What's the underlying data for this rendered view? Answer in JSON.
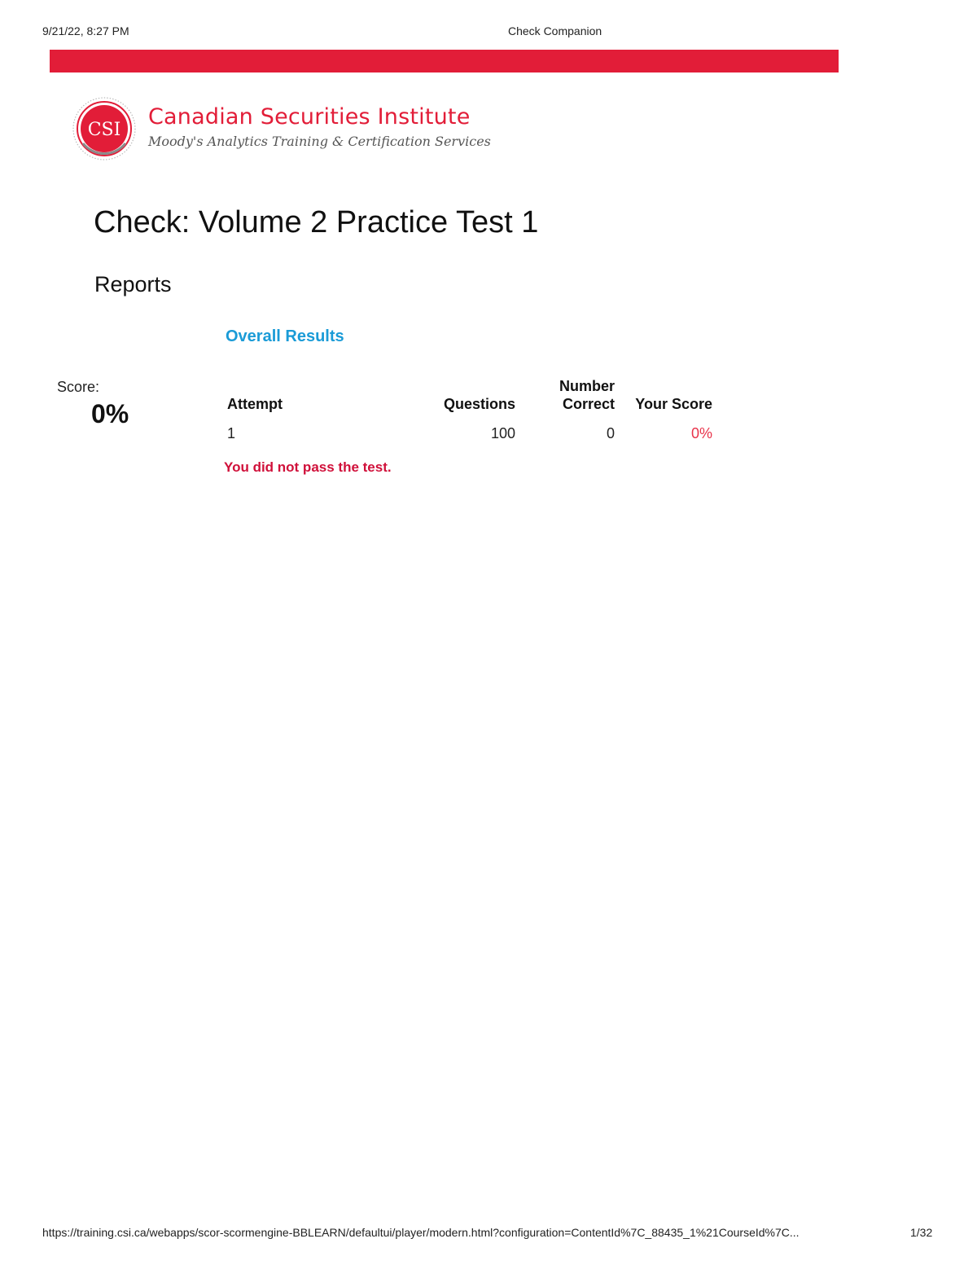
{
  "print_header": {
    "datetime": "9/21/22, 8:27 PM",
    "document_title": "Check Companion"
  },
  "brand": {
    "seal_text": "CSI",
    "name": "Canadian Securities Institute",
    "tagline": "Moody's Analytics Training & Certification Services",
    "seal_icon": "csi-seal-icon"
  },
  "colors": {
    "brand_red": "#e21d38",
    "link_blue": "#1a9bd7",
    "fail_red": "#d0103a",
    "score_red": "#e8334a"
  },
  "page": {
    "title": "Check: Volume 2 Practice Test 1",
    "section": "Reports",
    "subsection": "Overall Results"
  },
  "score": {
    "label": "Score:",
    "value": "0%"
  },
  "results_table": {
    "headers": {
      "attempt": "Attempt",
      "questions": "Questions",
      "number_correct_line1": "Number",
      "number_correct_line2": "Correct",
      "your_score": "Your Score"
    },
    "rows": [
      {
        "attempt": "1",
        "questions": "100",
        "number_correct": "0",
        "your_score": "0%"
      }
    ]
  },
  "result_message": "You did not pass the test.",
  "print_footer": {
    "url": "https://training.csi.ca/webapps/scor-scormengine-BBLEARN/defaultui/player/modern.html?configuration=ContentId%7C_88435_1%21CourseId%7C...",
    "page_number": "1/32"
  }
}
